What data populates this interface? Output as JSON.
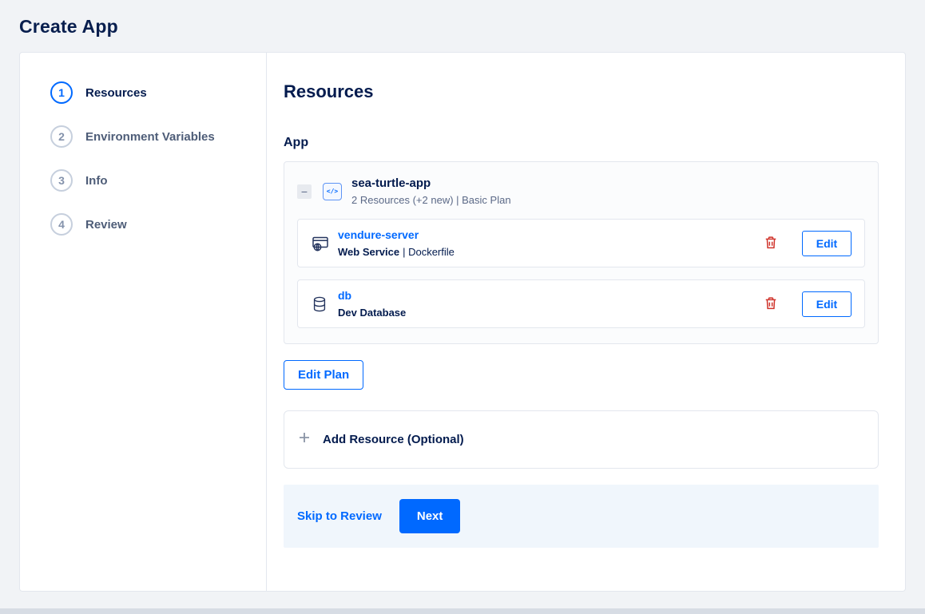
{
  "page": {
    "title": "Create App"
  },
  "stepper": {
    "steps": [
      {
        "number": "1",
        "label": "Resources"
      },
      {
        "number": "2",
        "label": "Environment Variables"
      },
      {
        "number": "3",
        "label": "Info"
      },
      {
        "number": "4",
        "label": "Review"
      }
    ]
  },
  "content": {
    "heading": "Resources",
    "section_label": "App",
    "app_group": {
      "name": "sea-turtle-app",
      "subtitle": "2 Resources (+2 new) | Basic Plan",
      "resources": [
        {
          "name": "vendure-server",
          "type": "Web Service",
          "detail": "| Dockerfile",
          "edit_label": "Edit"
        },
        {
          "name": "db",
          "type": "Dev Database",
          "detail": "",
          "edit_label": "Edit"
        }
      ]
    },
    "edit_plan_label": "Edit Plan",
    "add_resource_label": "Add Resource (Optional)",
    "footer": {
      "skip_label": "Skip to Review",
      "next_label": "Next"
    }
  },
  "icons": {
    "collapse_minus": "−",
    "app_code_glyph": "</>"
  },
  "colors": {
    "accent": "#0069ff",
    "heading_text": "#031b4e",
    "muted_text": "#5b6987",
    "danger": "#d0342c",
    "border": "#e3e7ee",
    "footer_bg": "#f0f6fc",
    "page_bg": "#f1f3f6"
  }
}
